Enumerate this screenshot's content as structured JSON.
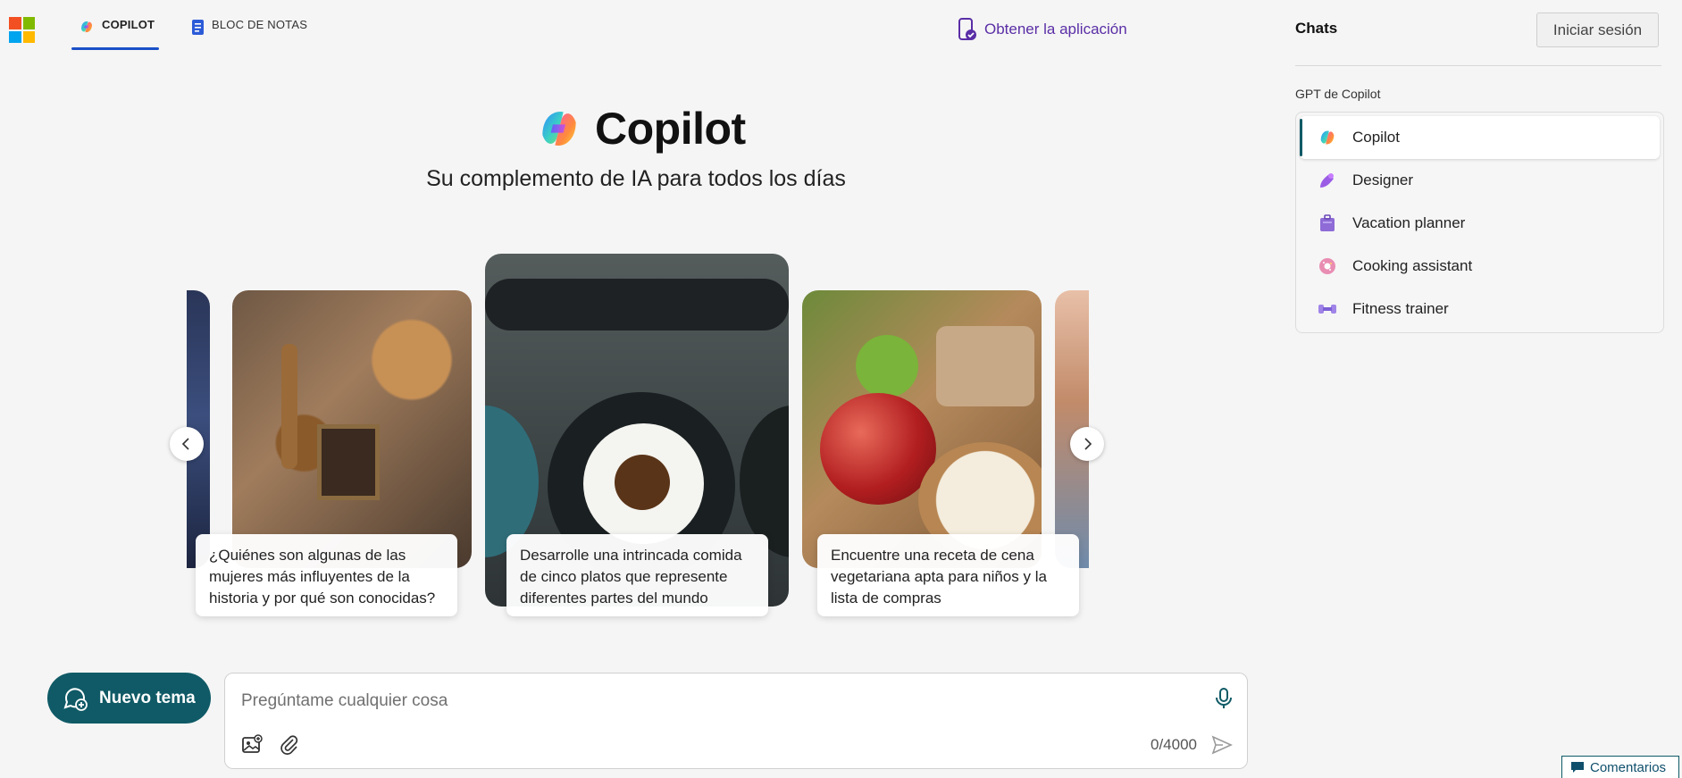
{
  "header": {
    "tabs": [
      {
        "label": "COPILOT",
        "icon": "copilot-icon",
        "active": true
      },
      {
        "label": "BLOC DE NOTAS",
        "icon": "notebook-icon",
        "active": false
      }
    ],
    "get_app_label": "Obtener la aplicación",
    "accent": "#1a4fc7"
  },
  "hero": {
    "title": "Copilot",
    "subtitle": "Su complemento de IA para todos los días"
  },
  "carousel": {
    "cards": [
      {
        "caption": "¿Quiénes son algunas de las mujeres más influyentes de la historia y por qué son conocidas?",
        "image": "bronze-historical-objects"
      },
      {
        "caption": "Desarrolle una intrincada comida de cinco platos que represente diferentes partes del mundo",
        "image": "plated-dishes-table"
      },
      {
        "caption": "Encuentre una receta de cena vegetariana apta para niños y la lista de compras",
        "image": "apple-rice-vegetables"
      }
    ]
  },
  "composer": {
    "new_topic_label": "Nuevo tema",
    "placeholder": "Pregúntame cualquier cosa",
    "value": "",
    "char_counter": "0/4000",
    "brand_color": "#0f5a66"
  },
  "sidebar": {
    "chats_label": "Chats",
    "signin_label": "Iniciar sesión",
    "gpt_section_label": "GPT de Copilot",
    "gpts": [
      {
        "label": "Copilot",
        "icon": "copilot-icon",
        "active": true
      },
      {
        "label": "Designer",
        "icon": "designer-icon",
        "active": false
      },
      {
        "label": "Vacation planner",
        "icon": "suitcase-icon",
        "active": false
      },
      {
        "label": "Cooking assistant",
        "icon": "donut-icon",
        "active": false
      },
      {
        "label": "Fitness trainer",
        "icon": "dumbbell-icon",
        "active": false
      }
    ]
  },
  "feedback_label": "Comentarios"
}
